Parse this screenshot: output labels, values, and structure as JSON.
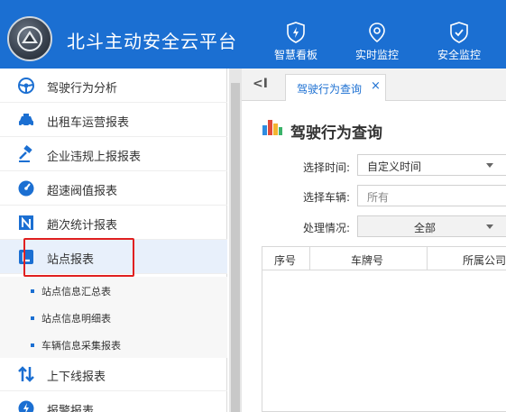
{
  "header": {
    "title": "北斗主动安全云平台",
    "nav": [
      {
        "label": "智慧看板",
        "icon": "shield-bolt-icon"
      },
      {
        "label": "实时监控",
        "icon": "location-pin-icon"
      },
      {
        "label": "安全监控",
        "icon": "shield-check-icon"
      }
    ],
    "brand_color": "#1b6fd2"
  },
  "sidebar": {
    "items": [
      {
        "label": "驾驶行为分析",
        "icon": "steering-wheel-icon"
      },
      {
        "label": "出租车运营报表",
        "icon": "taxi-icon"
      },
      {
        "label": "企业违规上报报表",
        "icon": "gavel-icon"
      },
      {
        "label": "超速阀值报表",
        "icon": "speedometer-icon"
      },
      {
        "label": "趟次统计报表",
        "icon": "route-icon"
      },
      {
        "label": "站点报表",
        "icon": "station-icon"
      },
      {
        "label": "上下线报表",
        "icon": "up-down-icon"
      },
      {
        "label": "报警报表",
        "icon": "alarm-icon"
      }
    ],
    "subitems": [
      {
        "label": "站点信息汇总表"
      },
      {
        "label": "站点信息明细表"
      },
      {
        "label": "车辆信息采集报表"
      }
    ],
    "active_index": 5,
    "highlight_color": "#e02020"
  },
  "tabs": {
    "back": "<I",
    "active": {
      "label": "驾驶行为查询",
      "close": "×"
    }
  },
  "main": {
    "title": "驾驶行为查询",
    "form": {
      "time_label": "选择时间:",
      "time_value": "自定义时间",
      "vehicle_label": "选择车辆:",
      "vehicle_placeholder": "所有",
      "status_label": "处理情况:",
      "status_value": "全部"
    },
    "table": {
      "columns": [
        "序号",
        "车牌号",
        "所属公司"
      ]
    }
  }
}
